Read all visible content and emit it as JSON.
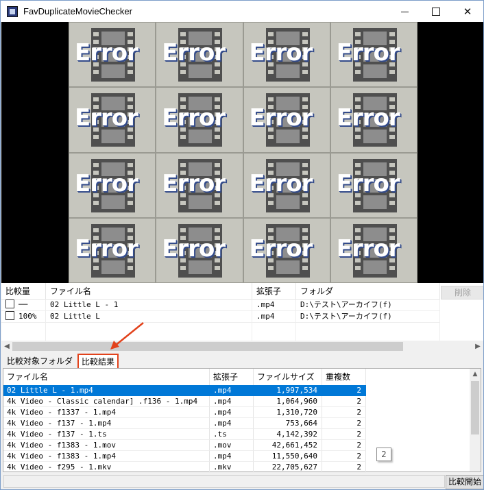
{
  "window": {
    "title": "FavDuplicateMovieChecker",
    "controls": {
      "minimize": "—",
      "maximize": "□",
      "close": "✕"
    }
  },
  "preview": {
    "thumbnail_text": "Error",
    "thumbnail_count": 16,
    "icon": "film-strip-icon"
  },
  "upper_table": {
    "columns": [
      "比較量",
      "ファイル名",
      "拡張子",
      "フォルダ"
    ],
    "delete_button": "削除",
    "rows": [
      {
        "ratio": "──",
        "name": "02 Little L - 1",
        "ext": ".mp4",
        "folder": "D:\\テスト\\アーカイフ(f)"
      },
      {
        "ratio": "100%",
        "name": "02 Little L",
        "ext": ".mp4",
        "folder": "D:\\テスト\\アーカイフ(f)"
      }
    ]
  },
  "tabs": [
    "比較対象フォルダ",
    "比較結果"
  ],
  "active_tab": "比較結果",
  "results_table": {
    "columns": [
      "ファイル名",
      "拡張子",
      "ファイルサイズ",
      "重複数"
    ],
    "rows": [
      {
        "name": "02 Little L - 1.mp4",
        "ext": ".mp4",
        "size": "1,997,534",
        "dup": "2"
      },
      {
        "name": "4k Video - Classic calendar] .f136 - 1.mp4",
        "ext": ".mp4",
        "size": "1,064,960",
        "dup": "2"
      },
      {
        "name": "4k Video - f1337 - 1.mp4",
        "ext": ".mp4",
        "size": "1,310,720",
        "dup": "2"
      },
      {
        "name": "4k Video - f137 - 1.mp4",
        "ext": ".mp4",
        "size": "753,664",
        "dup": "2"
      },
      {
        "name": "4k Video - f137 - 1.ts",
        "ext": ".ts",
        "size": "4,142,392",
        "dup": "2"
      },
      {
        "name": "4k Video - f1383 - 1.mov",
        "ext": ".mov",
        "size": "42,661,452",
        "dup": "2"
      },
      {
        "name": "4k Video - f1383 - 1.mp4",
        "ext": ".mp4",
        "size": "11,550,640",
        "dup": "2"
      },
      {
        "name": "4k Video - f295 - 1.mkv",
        "ext": ".mkv",
        "size": "22,705,627",
        "dup": "2"
      }
    ],
    "tooltip": "2"
  },
  "statusbar": {
    "start_button": "比較開始"
  },
  "colors": {
    "selection": "#0078d7",
    "highlight_border": "#e2421b"
  }
}
